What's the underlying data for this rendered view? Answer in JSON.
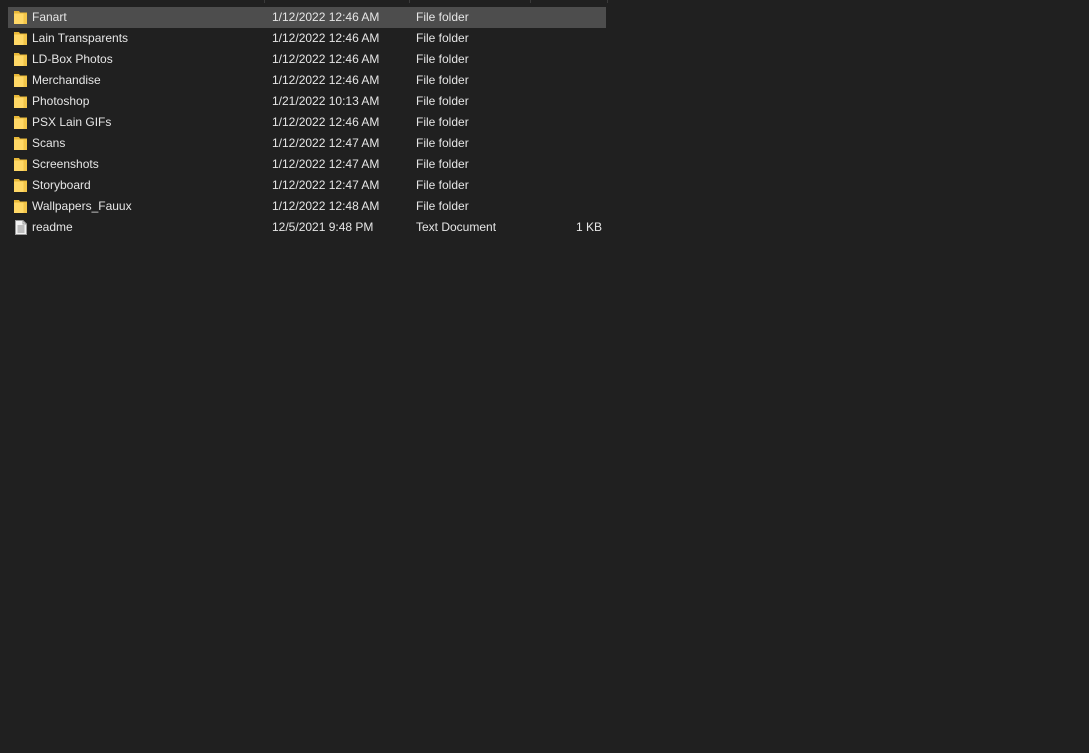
{
  "colors": {
    "background": "#202020",
    "selected_row": "#4d4d4d",
    "text": "#e6e6e6",
    "folder_icon": "#ffd866"
  },
  "files": [
    {
      "name": "Fanart",
      "date": "1/12/2022 12:46 AM",
      "type": "File folder",
      "size": "",
      "icon": "folder-icon",
      "selected": true
    },
    {
      "name": "Lain Transparents",
      "date": "1/12/2022 12:46 AM",
      "type": "File folder",
      "size": "",
      "icon": "folder-icon",
      "selected": false
    },
    {
      "name": "LD-Box Photos",
      "date": "1/12/2022 12:46 AM",
      "type": "File folder",
      "size": "",
      "icon": "folder-icon",
      "selected": false
    },
    {
      "name": "Merchandise",
      "date": "1/12/2022 12:46 AM",
      "type": "File folder",
      "size": "",
      "icon": "folder-icon",
      "selected": false
    },
    {
      "name": "Photoshop",
      "date": "1/21/2022 10:13 AM",
      "type": "File folder",
      "size": "",
      "icon": "folder-icon",
      "selected": false
    },
    {
      "name": "PSX Lain GIFs",
      "date": "1/12/2022 12:46 AM",
      "type": "File folder",
      "size": "",
      "icon": "folder-icon",
      "selected": false
    },
    {
      "name": "Scans",
      "date": "1/12/2022 12:47 AM",
      "type": "File folder",
      "size": "",
      "icon": "folder-icon",
      "selected": false
    },
    {
      "name": "Screenshots",
      "date": "1/12/2022 12:47 AM",
      "type": "File folder",
      "size": "",
      "icon": "folder-icon",
      "selected": false
    },
    {
      "name": "Storyboard",
      "date": "1/12/2022 12:47 AM",
      "type": "File folder",
      "size": "",
      "icon": "folder-icon",
      "selected": false
    },
    {
      "name": "Wallpapers_Fauux",
      "date": "1/12/2022 12:48 AM",
      "type": "File folder",
      "size": "",
      "icon": "folder-icon",
      "selected": false
    },
    {
      "name": "readme",
      "date": "12/5/2021 9:48 PM",
      "type": "Text Document",
      "size": "1 KB",
      "icon": "text-document-icon",
      "selected": false
    }
  ]
}
